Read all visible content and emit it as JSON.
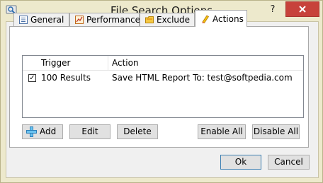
{
  "window": {
    "title": "File Search Options",
    "help_symbol": "?"
  },
  "tabs": [
    {
      "label": "General",
      "icon": "list-icon",
      "active": false
    },
    {
      "label": "Performance",
      "icon": "performance-icon",
      "active": false
    },
    {
      "label": "Exclude",
      "icon": "folder-icon",
      "active": false
    },
    {
      "label": "Actions",
      "icon": "actions-icon",
      "active": true
    }
  ],
  "actions_list": {
    "columns": [
      "Trigger",
      "Action"
    ],
    "rows": [
      {
        "checked": true,
        "trigger": "100 Results",
        "action": "Save HTML Report To: test@softpedia.com"
      }
    ]
  },
  "buttons": {
    "add": "Add",
    "edit": "Edit",
    "delete": "Delete",
    "enable_all": "Enable All",
    "disable_all": "Disable All",
    "ok": "Ok",
    "cancel": "Cancel"
  },
  "colors": {
    "frame": "#ede9cc",
    "close_button": "#c7423b",
    "client": "#f0f0f0",
    "button_face": "#e1e1e1"
  }
}
